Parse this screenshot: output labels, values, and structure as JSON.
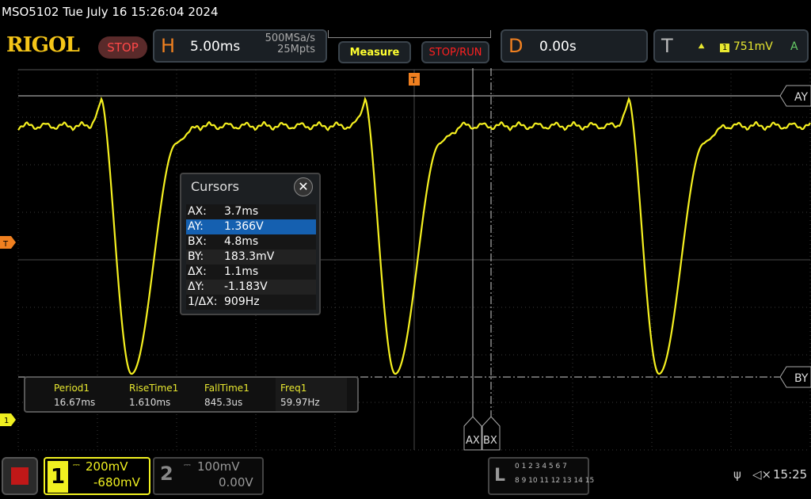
{
  "header": {
    "title": "MSO5102  Tue July 16 15:26:04 2024",
    "logo": "RIGOL",
    "run_state": "STOP"
  },
  "horizontal": {
    "label": "H",
    "timebase": "5.00ms",
    "sample_rate": "500MSa/s",
    "memory_depth": "25Mpts"
  },
  "buttons": {
    "measure": "Measure",
    "stop_run": "STOP/RUN"
  },
  "delay": {
    "label": "D",
    "value": "0.00s"
  },
  "trigger": {
    "label": "T",
    "source": "1",
    "level": "751mV",
    "mode": "A",
    "slope_icon": "rising-edge-icon"
  },
  "markers": {
    "trigger_level": "T",
    "ch1_offset": "1",
    "ay": "AY",
    "by": "BY",
    "ax": "AX",
    "bx": "BX"
  },
  "cursors": {
    "title": "Cursors",
    "rows": [
      {
        "k": "AX:",
        "v": "3.7ms"
      },
      {
        "k": "AY:",
        "v": "1.366V"
      },
      {
        "k": "BX:",
        "v": "4.8ms"
      },
      {
        "k": "BY:",
        "v": "183.3mV"
      },
      {
        "k": "ΔX:",
        "v": "1.1ms"
      },
      {
        "k": "ΔY:",
        "v": "-1.183V"
      },
      {
        "k": "1/ΔX:",
        "v": "909Hz"
      }
    ],
    "selected": 1
  },
  "measurements": [
    {
      "label": "Period1",
      "value": "16.67ms"
    },
    {
      "label": "RiseTime1",
      "value": "1.610ms"
    },
    {
      "label": "FallTime1",
      "value": "845.3us"
    },
    {
      "label": "Freq1",
      "value": "59.97Hz"
    }
  ],
  "channels": [
    {
      "num": "1",
      "scale": "200mV",
      "offset": "-680mV",
      "color": "#f0f020",
      "active": true
    },
    {
      "num": "2",
      "scale": "100mV",
      "offset": "0.00V",
      "color": "#888888",
      "active": false
    }
  ],
  "logic": {
    "label": "L",
    "row1": "0 1 2 3  4 5 6 7",
    "row2": "8 9 10 11 12 13 14 15"
  },
  "status": {
    "time": "15:25",
    "usb_icon": "usb-icon",
    "sound_icon": "mute-icon"
  },
  "colors": {
    "ch1": "#f0f020",
    "accent": "#f08020",
    "selected": "#1560b0"
  }
}
